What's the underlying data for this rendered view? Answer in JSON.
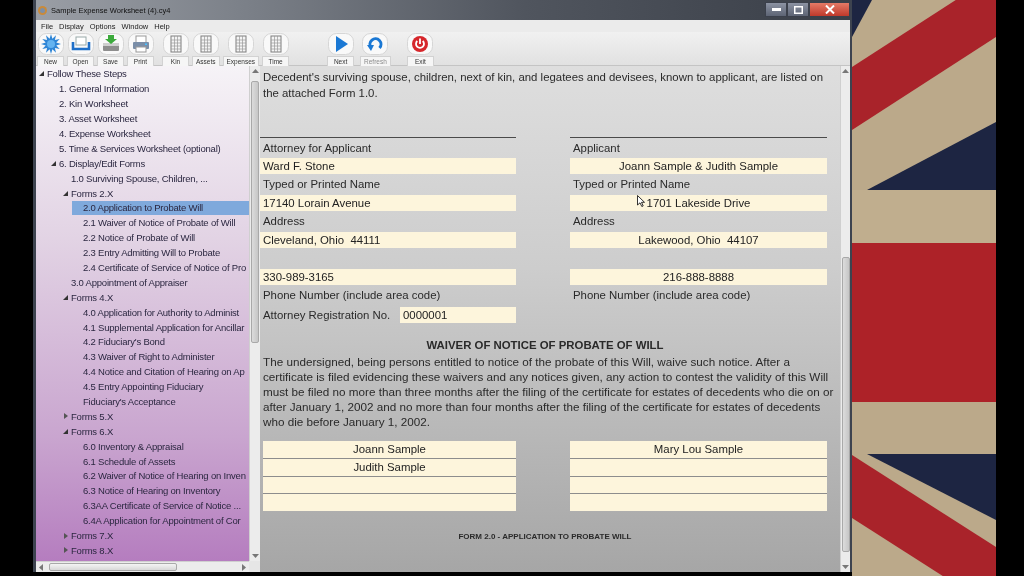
{
  "window": {
    "title": "Sample Expense Worksheet (4).cy4"
  },
  "menu": [
    "File",
    "Display",
    "Options",
    "Window",
    "Help"
  ],
  "toolbar": {
    "groups": [
      [
        {
          "label": "New",
          "disabled": false
        },
        {
          "label": "Open",
          "disabled": false
        },
        {
          "label": "Save",
          "disabled": false
        },
        {
          "label": "Print",
          "disabled": false
        }
      ],
      [
        {
          "label": "Kin",
          "disabled": false
        },
        {
          "label": "Assets",
          "disabled": false
        },
        {
          "label": "Expenses",
          "disabled": false
        },
        {
          "label": "Time",
          "disabled": false
        }
      ],
      [
        {
          "label": "Next",
          "disabled": false
        }
      ],
      [
        {
          "label": "Refresh",
          "disabled": true
        }
      ],
      [
        {
          "label": "Exit",
          "disabled": false
        }
      ]
    ]
  },
  "tree": [
    {
      "label": "Follow These Steps",
      "expanded": true,
      "selected": false,
      "children": [
        {
          "label": "1. General Information",
          "selected": false
        },
        {
          "label": "2. Kin Worksheet",
          "selected": false
        },
        {
          "label": "3. Asset Worksheet",
          "selected": false
        },
        {
          "label": "4. Expense Worksheet",
          "selected": false
        },
        {
          "label": "5. Time & Services Worksheet (optional)",
          "selected": false
        },
        {
          "label": "6. Display/Edit Forms",
          "expanded": true,
          "selected": false,
          "children": [
            {
              "label": "1.0 Surviving Spouse, Children, ...",
              "selected": false
            },
            {
              "label": "Forms 2.X",
              "expanded": true,
              "selected": false,
              "children": [
                {
                  "label": "2.0 Application to Probate Will",
                  "selected": true
                },
                {
                  "label": "2.1 Waiver of Notice of Probate of Will",
                  "selected": false
                },
                {
                  "label": "2.2 Notice of Probate of Will",
                  "selected": false
                },
                {
                  "label": "2.3 Entry Admitting Will to Probate",
                  "selected": false
                },
                {
                  "label": "2.4 Certificate of Service of Notice of Pro",
                  "selected": false
                }
              ]
            },
            {
              "label": "3.0 Appointment of Appraiser",
              "selected": false
            },
            {
              "label": "Forms 4.X",
              "expanded": true,
              "selected": false,
              "children": [
                {
                  "label": "4.0 Application for Authority to Administ",
                  "selected": false
                },
                {
                  "label": "4.1 Supplemental Application for Ancillar",
                  "selected": false
                },
                {
                  "label": "4.2 Fiduciary's Bond",
                  "selected": false
                },
                {
                  "label": "4.3 Waiver of Right to Administer",
                  "selected": false
                },
                {
                  "label": "4.4 Notice and Citation of Hearing on Ap",
                  "selected": false
                },
                {
                  "label": "4.5 Entry Appointing Fiduciary",
                  "selected": false
                },
                {
                  "label": "Fiduciary's Acceptance",
                  "selected": false
                }
              ]
            },
            {
              "label": "Forms 5.X",
              "expanded": false,
              "selected": false
            },
            {
              "label": "Forms 6.X",
              "expanded": true,
              "selected": false,
              "children": [
                {
                  "label": "6.0 Inventory & Appraisal",
                  "selected": false
                },
                {
                  "label": "6.1 Schedule of Assets",
                  "selected": false
                },
                {
                  "label": "6.2 Waiver of Notice of Hearing on Inven",
                  "selected": false
                },
                {
                  "label": "6.3 Notice of Hearing on Inventory",
                  "selected": false
                },
                {
                  "label": "6.3AA Certificate of Service of Notice ...",
                  "selected": false
                },
                {
                  "label": "6.4A Application for Appointment of Cor",
                  "selected": false
                }
              ]
            },
            {
              "label": "Forms 7.X",
              "expanded": false,
              "selected": false
            },
            {
              "label": "Forms 8.X",
              "expanded": false,
              "selected": false
            }
          ]
        }
      ]
    }
  ],
  "form": {
    "intro": "Decedent's surviving spouse, children, next of kin, and legatees and devisees, known to applicant, are listed on the attached Form 1.0.",
    "columns": [
      {
        "heading": "Attorney for Applicant",
        "fields": [
          {
            "value": "Ward F. Stone",
            "caption": "Typed or Printed Name"
          },
          {
            "value": "17140 Lorain Avenue",
            "caption": "Address"
          },
          {
            "value": "Cleveland, Ohio  44111"
          },
          {
            "value": "330-989-3165",
            "caption": "Phone Number (include area code)"
          }
        ],
        "registration": {
          "label": "Attorney Registration No.",
          "value": "0000001"
        }
      },
      {
        "heading": "Applicant",
        "fields": [
          {
            "value": "Joann Sample & Judith Sample",
            "caption": "Typed or Printed Name"
          },
          {
            "value": "1701 Lakeside Drive",
            "caption": "Address"
          },
          {
            "value": "Lakewood, Ohio  44107"
          },
          {
            "value": "216-888-8888",
            "caption": "Phone Number (include area code)"
          }
        ]
      }
    ],
    "waiver": {
      "title": "WAIVER OF NOTICE OF PROBATE OF WILL",
      "text": "The undersigned, being persons entitled to notice of the probate of this Will, waive such notice. After a certificate is filed evidencing these waivers and any notices given, any action to contest the validity of this Will must be filed no more than three months after the filing of the certificate for estates of decedents who die on or after January 1, 2002 and no more than four months after the filing of the certificate for estates of decedents who die before January 1, 2002.",
      "signatures": [
        [
          {
            "kind": "signed",
            "value": "Joann Sample"
          },
          {
            "kind": "signed",
            "value": "Judith Sample"
          },
          {
            "kind": "blank"
          },
          {
            "kind": "blank"
          }
        ],
        [
          {
            "kind": "signed",
            "value": "Mary Lou Sample"
          },
          {
            "kind": "blank"
          },
          {
            "kind": "blank"
          },
          {
            "kind": "blank"
          }
        ]
      ]
    },
    "footer": "FORM 2.0 - APPLICATION TO PROBATE WILL"
  }
}
